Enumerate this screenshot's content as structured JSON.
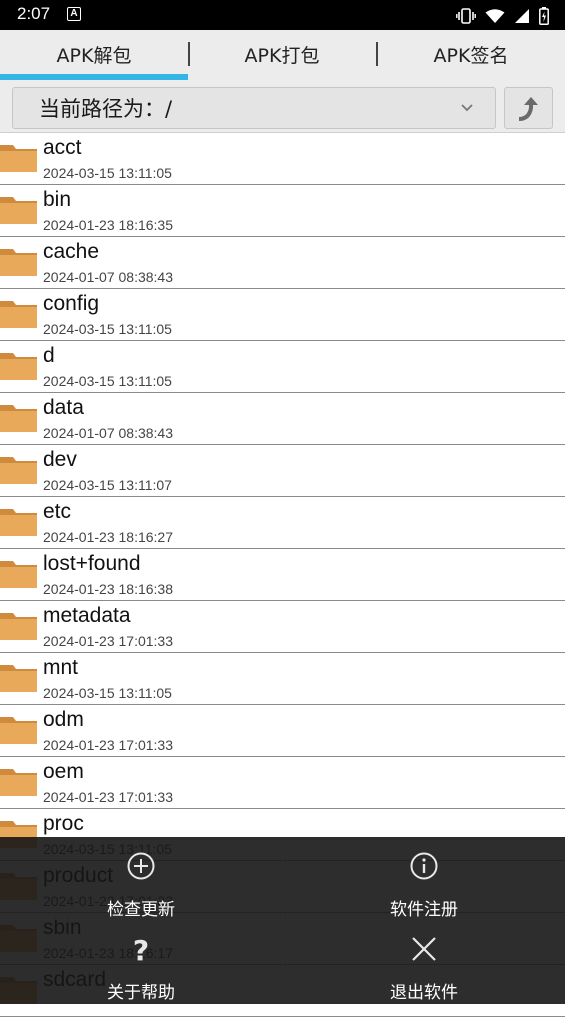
{
  "status_bar": {
    "time": "2:07",
    "notification_letter": "A"
  },
  "tabs": [
    {
      "label": "APK解包",
      "active": true
    },
    {
      "label": "APK打包",
      "active": false
    },
    {
      "label": "APK签名",
      "active": false
    }
  ],
  "path_bar": {
    "label": "当前路径为：/"
  },
  "files": [
    {
      "name": "acct",
      "date": "2024-03-15 13:11:05"
    },
    {
      "name": "bin",
      "date": "2024-01-23 18:16:35"
    },
    {
      "name": "cache",
      "date": "2024-01-07 08:38:43"
    },
    {
      "name": "config",
      "date": "2024-03-15 13:11:05"
    },
    {
      "name": "d",
      "date": "2024-03-15 13:11:05"
    },
    {
      "name": "data",
      "date": "2024-01-07 08:38:43"
    },
    {
      "name": "dev",
      "date": "2024-03-15 13:11:07"
    },
    {
      "name": "etc",
      "date": "2024-01-23 18:16:27"
    },
    {
      "name": "lost+found",
      "date": "2024-01-23 18:16:38"
    },
    {
      "name": "metadata",
      "date": "2024-01-23 17:01:33"
    },
    {
      "name": "mnt",
      "date": "2024-03-15 13:11:05"
    },
    {
      "name": "odm",
      "date": "2024-01-23 17:01:33"
    },
    {
      "name": "oem",
      "date": "2024-01-23 17:01:33"
    },
    {
      "name": "proc",
      "date": "2024-03-15 13:11:05"
    },
    {
      "name": "product",
      "date": "2024-01-23 17:01:33"
    },
    {
      "name": "sbin",
      "date": "2024-01-23 18:16:17"
    },
    {
      "name": "sdcard",
      "date": ""
    }
  ],
  "menu": {
    "check_update": "检查更新",
    "register": "软件注册",
    "help": "关于帮助",
    "exit": "退出软件"
  },
  "colors": {
    "tab_indicator": "#33b5e5",
    "folder": "#e8a95b"
  }
}
